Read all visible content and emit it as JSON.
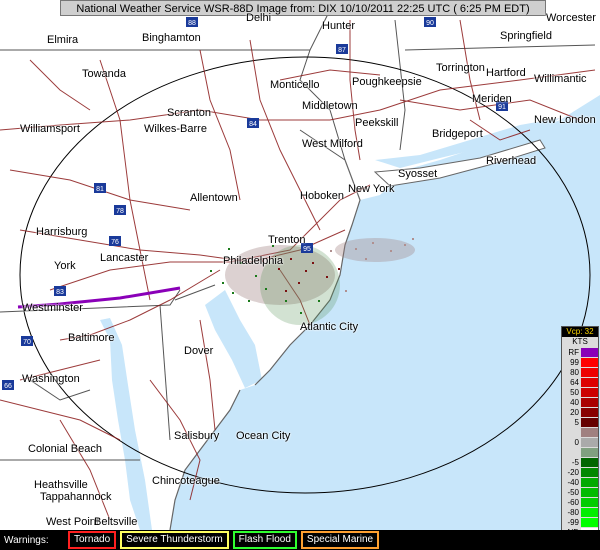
{
  "header": {
    "title": "National Weather Service WSR-88D Image  from: DIX 10/10/2011  22:25 UTC ( 6:25 PM EDT)"
  },
  "colors": {
    "land": "#ffffff",
    "water": "#c8e6fa",
    "roads": "#8b1a1a",
    "borders": "#555555",
    "coast": "#666666",
    "range_ring": "#000000"
  },
  "cities": [
    {
      "name": "Elmira"
    },
    {
      "name": "Binghamton"
    },
    {
      "name": "Delhi"
    },
    {
      "name": "Hunter"
    },
    {
      "name": "Worcester"
    },
    {
      "name": "Springfield"
    },
    {
      "name": "Towanda"
    },
    {
      "name": "Monticello"
    },
    {
      "name": "Poughkeepsie"
    },
    {
      "name": "Torrington"
    },
    {
      "name": "Hartford"
    },
    {
      "name": "Willimantic"
    },
    {
      "name": "Meriden"
    },
    {
      "name": "Middletown"
    },
    {
      "name": "Scranton"
    },
    {
      "name": "Wilkes-Barre"
    },
    {
      "name": "Peekskill"
    },
    {
      "name": "New London"
    },
    {
      "name": "Williamsport"
    },
    {
      "name": "Bridgeport"
    },
    {
      "name": "West Milford"
    },
    {
      "name": "Riverhead"
    },
    {
      "name": "Syosset"
    },
    {
      "name": "Allentown"
    },
    {
      "name": "Hoboken"
    },
    {
      "name": "New York"
    },
    {
      "name": "Harrisburg"
    },
    {
      "name": "Trenton"
    },
    {
      "name": "Lancaster"
    },
    {
      "name": "Philadelphia"
    },
    {
      "name": "York"
    },
    {
      "name": "Westminster"
    },
    {
      "name": "Atlantic City"
    },
    {
      "name": "Baltimore"
    },
    {
      "name": "Dover"
    },
    {
      "name": "Washington"
    },
    {
      "name": "Salisbury"
    },
    {
      "name": "Ocean City"
    },
    {
      "name": "Colonial Beach"
    },
    {
      "name": "Chincoteague"
    },
    {
      "name": "Heathsville"
    },
    {
      "name": "Tappahannock"
    },
    {
      "name": "West Point"
    },
    {
      "name": "Beltsville"
    }
  ],
  "interstates": [
    "88",
    "90",
    "87",
    "84",
    "81",
    "78",
    "76",
    "83",
    "70",
    "95",
    "66",
    "91"
  ],
  "legend": {
    "title": "Vcp: 32",
    "unit": "KTS",
    "rows": [
      {
        "label": "RF",
        "color": "#8a00b8"
      },
      {
        "label": "99",
        "color": "#ff0000"
      },
      {
        "label": "80",
        "color": "#ee0000"
      },
      {
        "label": "64",
        "color": "#dd0000"
      },
      {
        "label": "50",
        "color": "#cc0000"
      },
      {
        "label": "40",
        "color": "#aa0000"
      },
      {
        "label": "20",
        "color": "#880000"
      },
      {
        "label": "5",
        "color": "#660000"
      },
      {
        "label": "",
        "color": "#a08080"
      },
      {
        "label": "0",
        "color": "#aaaaaa"
      },
      {
        "label": "",
        "color": "#80a080"
      },
      {
        "label": "-5",
        "color": "#006600"
      },
      {
        "label": "-20",
        "color": "#008800"
      },
      {
        "label": "-40",
        "color": "#00aa00"
      },
      {
        "label": "-50",
        "color": "#00bb00"
      },
      {
        "label": "-60",
        "color": "#00cc00"
      },
      {
        "label": "-80",
        "color": "#00ee00"
      },
      {
        "label": "-99",
        "color": "#00ff00"
      },
      {
        "label": "ND",
        "color": "#ffffff"
      }
    ]
  },
  "warnings": {
    "label": "Warnings:",
    "items": [
      {
        "label": "Tornado",
        "color": "#ff2020"
      },
      {
        "label": "Severe Thunderstorm",
        "color": "#ffff60"
      },
      {
        "label": "Flash Flood",
        "color": "#30ff30"
      },
      {
        "label": "Special Marine",
        "color": "#ffa030"
      }
    ]
  }
}
